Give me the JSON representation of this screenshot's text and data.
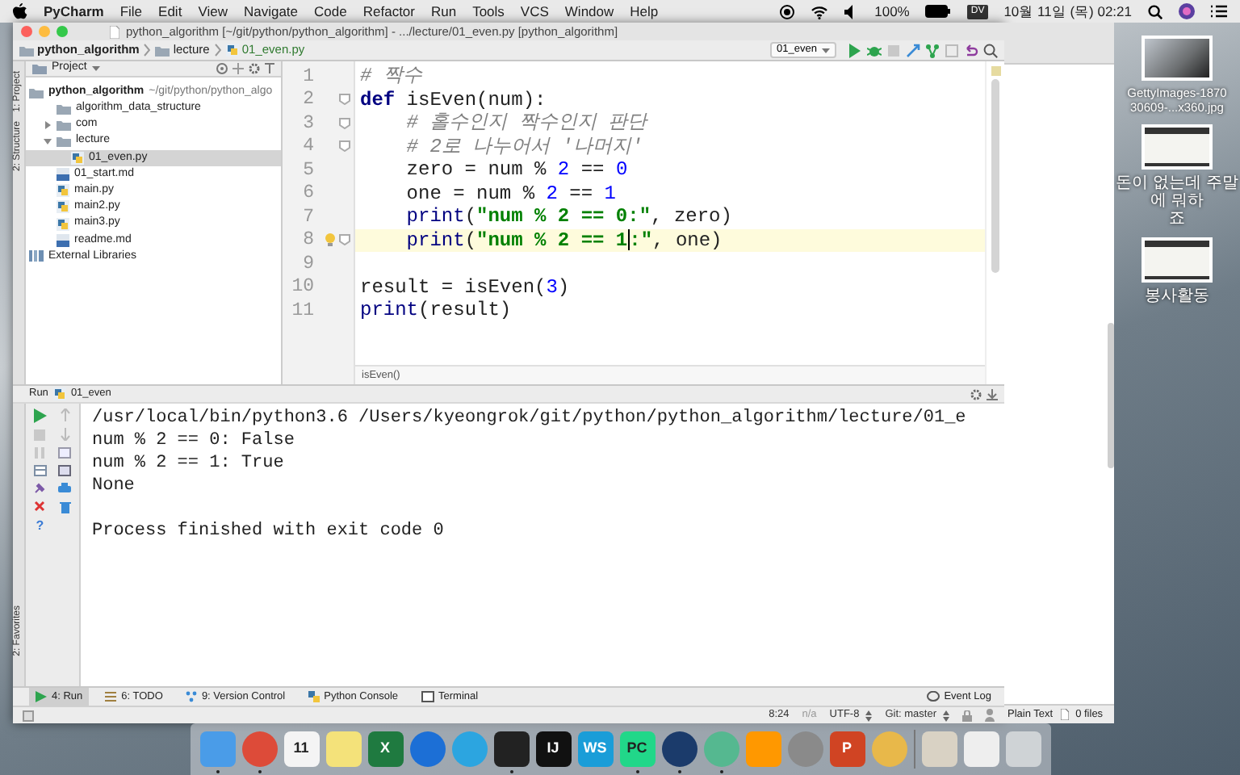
{
  "menubar": {
    "app": "PyCharm",
    "menus": [
      "File",
      "Edit",
      "View",
      "Navigate",
      "Code",
      "Refactor",
      "Run",
      "Tools",
      "VCS",
      "Window",
      "Help"
    ],
    "battery": "100%",
    "input_badge": "DV",
    "clock": "10월 11일 (목) 02:21"
  },
  "window": {
    "title": "python_algorithm [~/git/python/python_algorithm] - .../lecture/01_even.py [python_algorithm]"
  },
  "breadcrumbs": [
    {
      "label": "python_algorithm",
      "kind": "folder"
    },
    {
      "label": "lecture",
      "kind": "folder"
    },
    {
      "label": "01_even.py",
      "kind": "py"
    }
  ],
  "run_config": "01_even",
  "side_tabs": [
    "1: Project",
    "2: Structure"
  ],
  "favorites_tab": "2: Favorites",
  "project": {
    "title": "Project",
    "tree": [
      {
        "label": "python_algorithm",
        "path": "~/git/python/python_algo",
        "kind": "folder",
        "selected": false,
        "children": [
          {
            "label": "algorithm_data_structure",
            "kind": "folder",
            "selected": false
          },
          {
            "label": "com",
            "kind": "folder",
            "expanded": false,
            "selected": false
          },
          {
            "label": "lecture",
            "kind": "folder",
            "expanded": true,
            "selected": false,
            "children": [
              {
                "label": "01_even.py",
                "kind": "py",
                "selected": true
              }
            ]
          },
          {
            "label": "01_start.md",
            "kind": "md",
            "selected": false
          },
          {
            "label": "main.py",
            "kind": "py",
            "selected": false
          },
          {
            "label": "main2.py",
            "kind": "py",
            "selected": false
          },
          {
            "label": "main3.py",
            "kind": "py",
            "selected": false
          },
          {
            "label": "readme.md",
            "kind": "md",
            "selected": false
          }
        ]
      },
      {
        "label": "External Libraries",
        "kind": "library",
        "selected": false
      }
    ]
  },
  "editor": {
    "breadcrumb": "isEven()",
    "lines": [
      {
        "number": "1",
        "current": false,
        "fold": false,
        "tokens": [
          {
            "kind": "comment",
            "text": "# 짝수"
          }
        ]
      },
      {
        "number": "2",
        "current": false,
        "fold": true,
        "tokens": [
          {
            "kind": "keyword",
            "text": "def"
          },
          {
            "kind": "plain",
            "text": " isEven(num):"
          }
        ]
      },
      {
        "number": "3",
        "current": false,
        "fold": true,
        "tokens": [
          {
            "kind": "comment",
            "text": "    # 홀수인지 짝수인지 판단"
          }
        ]
      },
      {
        "number": "4",
        "current": false,
        "fold": true,
        "tokens": [
          {
            "kind": "comment",
            "text": "    # 2로 나누어서 '나머지'"
          }
        ]
      },
      {
        "number": "5",
        "current": false,
        "fold": false,
        "tokens": [
          {
            "kind": "plain",
            "text": "    zero = num % "
          },
          {
            "kind": "number",
            "text": "2"
          },
          {
            "kind": "plain",
            "text": " == "
          },
          {
            "kind": "number",
            "text": "0"
          }
        ]
      },
      {
        "number": "6",
        "current": false,
        "fold": false,
        "tokens": [
          {
            "kind": "plain",
            "text": "    one = num % "
          },
          {
            "kind": "number",
            "text": "2"
          },
          {
            "kind": "plain",
            "text": " == "
          },
          {
            "kind": "number",
            "text": "1"
          }
        ]
      },
      {
        "number": "7",
        "current": false,
        "fold": false,
        "tokens": [
          {
            "kind": "builtin",
            "text": "    print"
          },
          {
            "kind": "plain",
            "text": "("
          },
          {
            "kind": "string",
            "text": "\"num % 2 == 0:\""
          },
          {
            "kind": "plain",
            "text": ", zero)"
          }
        ]
      },
      {
        "number": "8",
        "current": true,
        "fold": true,
        "bulb": true,
        "tokens": [
          {
            "kind": "builtin",
            "text": "    print"
          },
          {
            "kind": "plain",
            "text": "("
          },
          {
            "kind": "string",
            "text": "\"num % 2 == 1"
          },
          {
            "kind": "caret"
          },
          {
            "kind": "string",
            "text": ":\""
          },
          {
            "kind": "plain",
            "text": ", one)"
          }
        ]
      },
      {
        "number": "9",
        "current": false,
        "fold": false
      },
      {
        "number": "10",
        "current": false,
        "fold": false,
        "tokens": [
          {
            "kind": "plain",
            "text": "result = isEven("
          },
          {
            "kind": "number",
            "text": "3"
          },
          {
            "kind": "plain",
            "text": ")"
          }
        ]
      },
      {
        "number": "11",
        "current": false,
        "fold": false,
        "tokens": [
          {
            "kind": "builtin",
            "text": "print"
          },
          {
            "kind": "plain",
            "text": "(result)"
          }
        ]
      }
    ]
  },
  "run": {
    "label": "Run",
    "config": "01_even",
    "help": "?",
    "output": [
      [
        "/usr/local/bin/python3.6 /Users/kyeongrok/git/python/python_algorithm/lecture/01_e",
        "num % 2 == 0: False",
        "num % 2 == 1: True",
        "None"
      ],
      [
        "Process finished with exit code 0"
      ]
    ]
  },
  "tool_tabs": [
    {
      "label": "4: Run",
      "kind": "run",
      "selected": true
    },
    {
      "label": "6: TODO",
      "kind": "todo",
      "selected": false
    },
    {
      "label": "9: Version Control",
      "kind": "vcs",
      "selected": false
    },
    {
      "label": "Python Console",
      "kind": "console",
      "selected": false
    },
    {
      "label": "Terminal",
      "kind": "terminal",
      "selected": false
    }
  ],
  "event_log": "Event Log",
  "status": [
    "8:24",
    "n/a",
    "UTF-8",
    "Git: master"
  ],
  "background_window": {
    "status": [
      "Plain Text",
      "0 files"
    ]
  },
  "desktop": [
    {
      "kind": "photo",
      "label_lines": [
        "GettyImages-1870",
        "30609-...x360.jpg"
      ]
    },
    {
      "kind": "screenshot",
      "label_lines": [
        "돈이 없는데 주말에 뭐하",
        "죠"
      ]
    },
    {
      "kind": "screenshot",
      "label_lines": [
        "봉사활동"
      ]
    }
  ],
  "dock": [
    {
      "kind": "square",
      "color": "#4a9ce8",
      "running": true
    },
    {
      "kind": "round",
      "color": "#dd4b39",
      "running": true
    },
    {
      "kind": "square",
      "color": "#f4f4f4",
      "label": "11",
      "running": false
    },
    {
      "kind": "square",
      "color": "#f4e27a",
      "running": false
    },
    {
      "kind": "square",
      "color": "#1f7a40",
      "label": "X",
      "running": false
    },
    {
      "kind": "round",
      "color": "#1c6fd6",
      "running": false
    },
    {
      "kind": "round",
      "color": "#2ca5e0",
      "running": false
    },
    {
      "kind": "square",
      "color": "#222222",
      "running": true
    },
    {
      "kind": "square",
      "color": "#111111",
      "label": "IJ",
      "running": false
    },
    {
      "kind": "square",
      "color": "#1a9dd8",
      "label": "WS",
      "running": false
    },
    {
      "kind": "square",
      "color": "#21d789",
      "label": "PC",
      "running": true
    },
    {
      "kind": "round",
      "color": "#1b3b6b",
      "running": true
    },
    {
      "kind": "round",
      "color": "#55b890",
      "running": true
    },
    {
      "kind": "square",
      "color": "#ff9800",
      "running": false
    },
    {
      "kind": "round",
      "color": "#8a8a8a",
      "running": false
    },
    {
      "kind": "square",
      "color": "#d04423",
      "label": "P",
      "running": false
    },
    {
      "kind": "round",
      "color": "#e8b84a",
      "running": false
    },
    {
      "kind": "separator"
    },
    {
      "kind": "square",
      "color": "#d9d2c4",
      "running": false
    },
    {
      "kind": "square",
      "color": "#eeeeee",
      "running": false
    },
    {
      "kind": "square",
      "color": "#cfd3d6",
      "running": false
    }
  ]
}
